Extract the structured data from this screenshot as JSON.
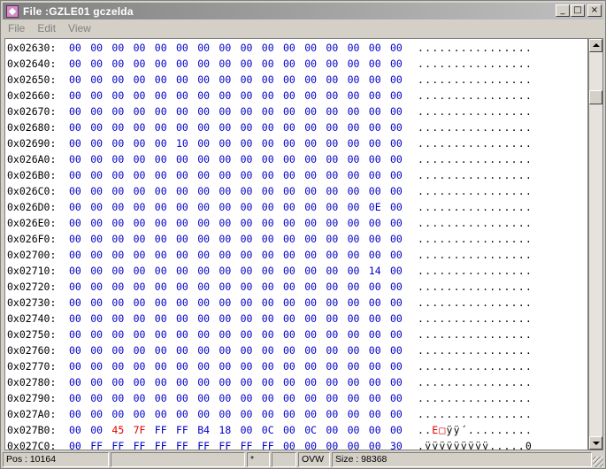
{
  "window": {
    "title": "File :GZLE01 gczelda",
    "buttons": {
      "minimize": "_",
      "maximize": "□",
      "close": "×"
    }
  },
  "menu": {
    "items": [
      "File",
      "Edit",
      "View"
    ]
  },
  "hex": {
    "rows": [
      {
        "addr": "0x02630:",
        "bytes": [
          "00",
          "00",
          "00",
          "00",
          "00",
          "00",
          "00",
          "00",
          "00",
          "00",
          "00",
          "00",
          "00",
          "00",
          "00",
          "00"
        ],
        "ascii": "................"
      },
      {
        "addr": "0x02640:",
        "bytes": [
          "00",
          "00",
          "00",
          "00",
          "00",
          "00",
          "00",
          "00",
          "00",
          "00",
          "00",
          "00",
          "00",
          "00",
          "00",
          "00"
        ],
        "ascii": "................"
      },
      {
        "addr": "0x02650:",
        "bytes": [
          "00",
          "00",
          "00",
          "00",
          "00",
          "00",
          "00",
          "00",
          "00",
          "00",
          "00",
          "00",
          "00",
          "00",
          "00",
          "00"
        ],
        "ascii": "................"
      },
      {
        "addr": "0x02660:",
        "bytes": [
          "00",
          "00",
          "00",
          "00",
          "00",
          "00",
          "00",
          "00",
          "00",
          "00",
          "00",
          "00",
          "00",
          "00",
          "00",
          "00"
        ],
        "ascii": "................"
      },
      {
        "addr": "0x02670:",
        "bytes": [
          "00",
          "00",
          "00",
          "00",
          "00",
          "00",
          "00",
          "00",
          "00",
          "00",
          "00",
          "00",
          "00",
          "00",
          "00",
          "00"
        ],
        "ascii": "................"
      },
      {
        "addr": "0x02680:",
        "bytes": [
          "00",
          "00",
          "00",
          "00",
          "00",
          "00",
          "00",
          "00",
          "00",
          "00",
          "00",
          "00",
          "00",
          "00",
          "00",
          "00"
        ],
        "ascii": "................"
      },
      {
        "addr": "0x02690:",
        "bytes": [
          "00",
          "00",
          "00",
          "00",
          "00",
          "10",
          "00",
          "00",
          "00",
          "00",
          "00",
          "00",
          "00",
          "00",
          "00",
          "00"
        ],
        "ascii": "................"
      },
      {
        "addr": "0x026A0:",
        "bytes": [
          "00",
          "00",
          "00",
          "00",
          "00",
          "00",
          "00",
          "00",
          "00",
          "00",
          "00",
          "00",
          "00",
          "00",
          "00",
          "00"
        ],
        "ascii": "................"
      },
      {
        "addr": "0x026B0:",
        "bytes": [
          "00",
          "00",
          "00",
          "00",
          "00",
          "00",
          "00",
          "00",
          "00",
          "00",
          "00",
          "00",
          "00",
          "00",
          "00",
          "00"
        ],
        "ascii": "................"
      },
      {
        "addr": "0x026C0:",
        "bytes": [
          "00",
          "00",
          "00",
          "00",
          "00",
          "00",
          "00",
          "00",
          "00",
          "00",
          "00",
          "00",
          "00",
          "00",
          "00",
          "00"
        ],
        "ascii": "................"
      },
      {
        "addr": "0x026D0:",
        "bytes": [
          "00",
          "00",
          "00",
          "00",
          "00",
          "00",
          "00",
          "00",
          "00",
          "00",
          "00",
          "00",
          "00",
          "00",
          "0E",
          "00"
        ],
        "ascii": "................"
      },
      {
        "addr": "0x026E0:",
        "bytes": [
          "00",
          "00",
          "00",
          "00",
          "00",
          "00",
          "00",
          "00",
          "00",
          "00",
          "00",
          "00",
          "00",
          "00",
          "00",
          "00"
        ],
        "ascii": "................"
      },
      {
        "addr": "0x026F0:",
        "bytes": [
          "00",
          "00",
          "00",
          "00",
          "00",
          "00",
          "00",
          "00",
          "00",
          "00",
          "00",
          "00",
          "00",
          "00",
          "00",
          "00"
        ],
        "ascii": "................"
      },
      {
        "addr": "0x02700:",
        "bytes": [
          "00",
          "00",
          "00",
          "00",
          "00",
          "00",
          "00",
          "00",
          "00",
          "00",
          "00",
          "00",
          "00",
          "00",
          "00",
          "00"
        ],
        "ascii": "................"
      },
      {
        "addr": "0x02710:",
        "bytes": [
          "00",
          "00",
          "00",
          "00",
          "00",
          "00",
          "00",
          "00",
          "00",
          "00",
          "00",
          "00",
          "00",
          "00",
          "14",
          "00"
        ],
        "ascii": "................"
      },
      {
        "addr": "0x02720:",
        "bytes": [
          "00",
          "00",
          "00",
          "00",
          "00",
          "00",
          "00",
          "00",
          "00",
          "00",
          "00",
          "00",
          "00",
          "00",
          "00",
          "00"
        ],
        "ascii": "................"
      },
      {
        "addr": "0x02730:",
        "bytes": [
          "00",
          "00",
          "00",
          "00",
          "00",
          "00",
          "00",
          "00",
          "00",
          "00",
          "00",
          "00",
          "00",
          "00",
          "00",
          "00"
        ],
        "ascii": "................"
      },
      {
        "addr": "0x02740:",
        "bytes": [
          "00",
          "00",
          "00",
          "00",
          "00",
          "00",
          "00",
          "00",
          "00",
          "00",
          "00",
          "00",
          "00",
          "00",
          "00",
          "00"
        ],
        "ascii": "................"
      },
      {
        "addr": "0x02750:",
        "bytes": [
          "00",
          "00",
          "00",
          "00",
          "00",
          "00",
          "00",
          "00",
          "00",
          "00",
          "00",
          "00",
          "00",
          "00",
          "00",
          "00"
        ],
        "ascii": "................"
      },
      {
        "addr": "0x02760:",
        "bytes": [
          "00",
          "00",
          "00",
          "00",
          "00",
          "00",
          "00",
          "00",
          "00",
          "00",
          "00",
          "00",
          "00",
          "00",
          "00",
          "00"
        ],
        "ascii": "................"
      },
      {
        "addr": "0x02770:",
        "bytes": [
          "00",
          "00",
          "00",
          "00",
          "00",
          "00",
          "00",
          "00",
          "00",
          "00",
          "00",
          "00",
          "00",
          "00",
          "00",
          "00"
        ],
        "ascii": "................"
      },
      {
        "addr": "0x02780:",
        "bytes": [
          "00",
          "00",
          "00",
          "00",
          "00",
          "00",
          "00",
          "00",
          "00",
          "00",
          "00",
          "00",
          "00",
          "00",
          "00",
          "00"
        ],
        "ascii": "................"
      },
      {
        "addr": "0x02790:",
        "bytes": [
          "00",
          "00",
          "00",
          "00",
          "00",
          "00",
          "00",
          "00",
          "00",
          "00",
          "00",
          "00",
          "00",
          "00",
          "00",
          "00"
        ],
        "ascii": "................"
      },
      {
        "addr": "0x027A0:",
        "bytes": [
          "00",
          "00",
          "00",
          "00",
          "00",
          "00",
          "00",
          "00",
          "00",
          "00",
          "00",
          "00",
          "00",
          "00",
          "00",
          "00"
        ],
        "ascii": "................"
      },
      {
        "addr": "0x027B0:",
        "bytes": [
          "00",
          "00",
          "45",
          "7F",
          "FF",
          "FF",
          "B4",
          "18",
          "00",
          "0C",
          "00",
          "0C",
          "00",
          "00",
          "00",
          "00"
        ],
        "red": [
          2,
          3
        ],
        "ascii_red": "E□",
        "ascii_pre": "..",
        "ascii_post": "ÿÿ´........."
      },
      {
        "addr": "0x027C0:",
        "bytes": [
          "00",
          "FF",
          "FF",
          "FF",
          "FF",
          "FF",
          "FF",
          "FF",
          "FF",
          "FF",
          "00",
          "00",
          "00",
          "00",
          "00",
          "30"
        ],
        "ascii": ".ÿÿÿÿÿÿÿÿÿ.....0"
      }
    ]
  },
  "status": {
    "pos": "Pos : 10164",
    "blank1": "",
    "modified": "*",
    "blank2": "",
    "mode": "OVW",
    "size": "Size : 98368"
  },
  "colors": {
    "byte": "#0000c8",
    "highlight": "#e00000",
    "title_grad_start": "#808080"
  }
}
